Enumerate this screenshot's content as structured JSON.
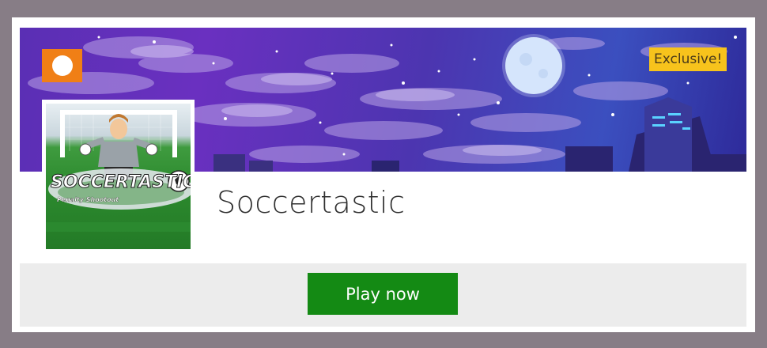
{
  "game": {
    "title": "Soccertastic",
    "badge": "Exclusive!",
    "thumbnail_logo_text": "SOCCERTASTIC",
    "thumbnail_subtitle": "Penalty Shootout"
  },
  "actions": {
    "play_label": "Play now"
  },
  "icons": {
    "back": "chevron-left-icon"
  },
  "colors": {
    "page_background": "#877d86",
    "back_button": "#f07f16",
    "badge": "#f7c31c",
    "play_button": "#148a14",
    "footer": "#ececec"
  }
}
